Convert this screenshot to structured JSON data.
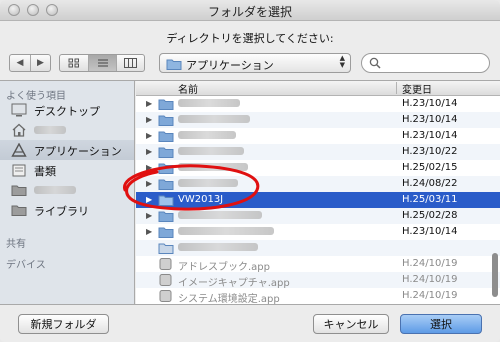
{
  "window": {
    "title": "フォルダを選択",
    "prompt": "ディレクトリを選択してください:"
  },
  "toolbar": {
    "nav_back": "◀",
    "nav_forward": "▶",
    "location": "アプリケーション",
    "search_placeholder": ""
  },
  "sidebar": {
    "favorites_header": "よく使う項目",
    "shared_header": "共有",
    "devices_header": "デバイス",
    "items": [
      {
        "label": "デスクトップ",
        "icon": "desktop-icon"
      },
      {
        "label": "",
        "icon": "home-icon"
      },
      {
        "label": "アプリケーション",
        "icon": "applications-icon",
        "selected": true
      },
      {
        "label": "書類",
        "icon": "documents-icon"
      },
      {
        "label": "",
        "icon": "folder-icon"
      },
      {
        "label": "ライブラリ",
        "icon": "folder-icon"
      }
    ]
  },
  "list": {
    "col_name": "名前",
    "col_modified": "変更日",
    "rows": [
      {
        "name": "",
        "date": "H.23/10/14",
        "blurred": true
      },
      {
        "name": "",
        "date": "H.23/10/14",
        "blurred": true
      },
      {
        "name": "",
        "date": "H.23/10/14",
        "blurred": true
      },
      {
        "name": "",
        "date": "H.23/10/22",
        "blurred": true
      },
      {
        "name": "",
        "date": "H.25/02/15",
        "blurred": true
      },
      {
        "name": "",
        "date": "H.24/08/22",
        "blurred": true
      },
      {
        "name": "VW2013J",
        "date": "H.25/03/11",
        "selected": true
      },
      {
        "name": "",
        "date": "H.25/02/28",
        "blurred": true
      },
      {
        "name": "",
        "date": "H.23/10/14",
        "blurred": true
      },
      {
        "name": "",
        "date": "",
        "blurred": true,
        "dim": true
      },
      {
        "name": "アドレスブック.app",
        "date": "H.24/10/19",
        "dim": true
      },
      {
        "name": "イメージキャプチャ.app",
        "date": "H.24/10/19",
        "dim": true
      },
      {
        "name": "システム環境設定.app",
        "date": "H.24/10/19",
        "dim": true
      }
    ]
  },
  "footer": {
    "new_folder": "新規フォルダ",
    "cancel": "キャンセル",
    "choose": "選択"
  },
  "colors": {
    "selection": "#2a5cc9",
    "annotation": "#e01010",
    "folder": "#7fa8d8"
  }
}
